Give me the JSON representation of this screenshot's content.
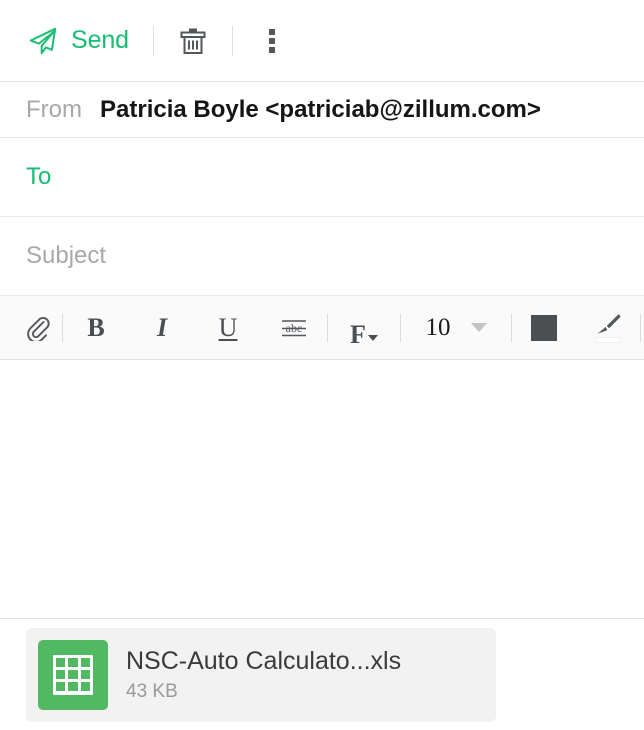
{
  "window": {
    "title": "Compose Mail"
  },
  "action_bar": {
    "send": {
      "label": "Send",
      "icon": "send-paper-plane-icon",
      "color": "#17bd72"
    },
    "delete": {
      "label": "Discard draft",
      "icon": "trash-icon"
    },
    "more": {
      "label": "More options",
      "icon": "kebab-menu-icon"
    }
  },
  "fields": {
    "from": {
      "label": "From",
      "value": "Patricia Boyle <patriciab@zillum.com>"
    },
    "to": {
      "label": "To",
      "value": "",
      "placeholder": "To",
      "accent_color": "#17bd72"
    },
    "subject": {
      "label": "Subject",
      "value": "",
      "placeholder": "Subject"
    }
  },
  "toolbar": {
    "attach": {
      "label": "Attach",
      "icon": "paperclip-icon"
    },
    "bold": {
      "label": "B",
      "icon": "bold-icon"
    },
    "italic": {
      "label": "I",
      "icon": "italic-icon"
    },
    "underline": {
      "label": "U",
      "icon": "underline-icon"
    },
    "strikethrough": {
      "label": "abc",
      "icon": "strikethrough-icon"
    },
    "font_family": {
      "label": "F",
      "icon": "font-family-icon"
    },
    "font_size": {
      "value": "10",
      "icon": "chevron-down-icon"
    },
    "text_color": {
      "label": "Text color",
      "icon": "color-swatch-icon",
      "color": "#4c4f51"
    },
    "highlight": {
      "label": "Highlight color",
      "icon": "brush-icon",
      "color": "#ffffff"
    }
  },
  "body": {
    "content": "",
    "placeholder": ""
  },
  "attachments": [
    {
      "name": "NSC-Auto Calculato...xls",
      "size": "43 KB",
      "type": "spreadsheet",
      "icon": "spreadsheet-file-icon",
      "icon_color": "#52b963"
    }
  ]
}
